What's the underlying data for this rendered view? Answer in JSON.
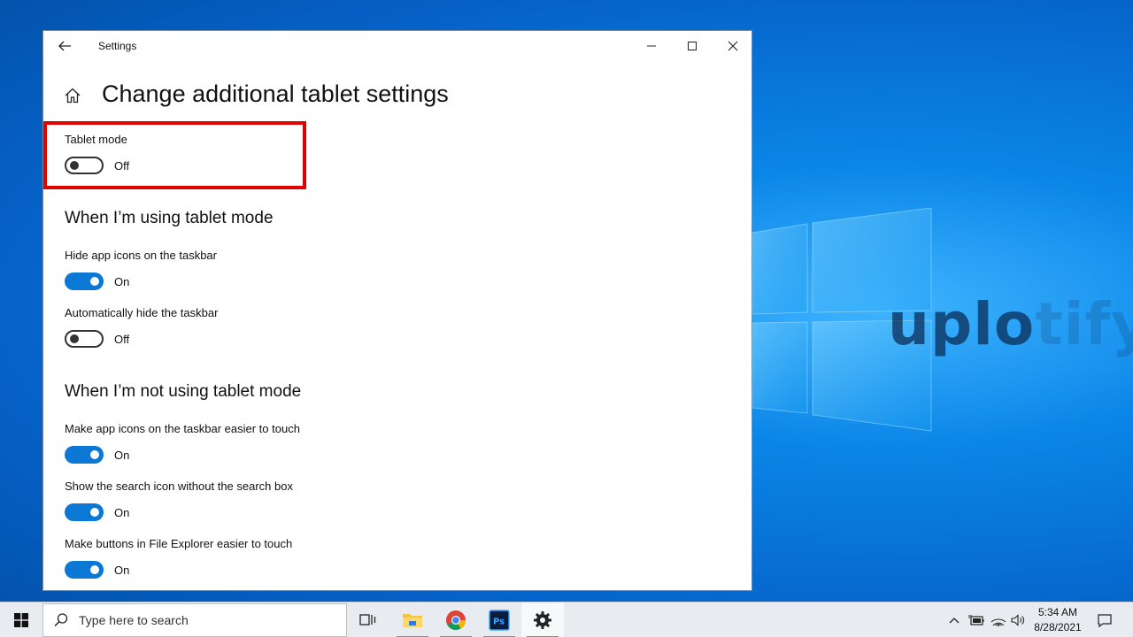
{
  "window": {
    "title": "Settings",
    "page_title": "Change additional tablet settings"
  },
  "tablet_mode": {
    "label": "Tablet mode",
    "state": "Off",
    "value": false
  },
  "sections": [
    {
      "title": "When I’m using tablet mode",
      "settings": [
        {
          "label": "Hide app icons on the taskbar",
          "state": "On",
          "value": true
        },
        {
          "label": "Automatically hide the taskbar",
          "state": "Off",
          "value": false
        }
      ]
    },
    {
      "title": "When I’m not using tablet mode",
      "settings": [
        {
          "label": "Make app icons on the taskbar easier to touch",
          "state": "On",
          "value": true
        },
        {
          "label": "Show the search icon without the search box",
          "state": "On",
          "value": true
        },
        {
          "label": "Make buttons in File Explorer easier to touch",
          "state": "On",
          "value": true
        }
      ]
    }
  ],
  "taskbar": {
    "search_placeholder": "Type here to search",
    "apps": [
      "task-view-icon",
      "file-explorer-icon",
      "chrome-icon",
      "photoshop-icon",
      "settings-gear-icon"
    ],
    "time": "5:34 AM",
    "date": "8/28/2021"
  },
  "desktop": {
    "watermark_main": "uplo",
    "watermark_faded": "tify"
  },
  "colors": {
    "accent": "#0a78d4",
    "highlight": "#e00000"
  }
}
